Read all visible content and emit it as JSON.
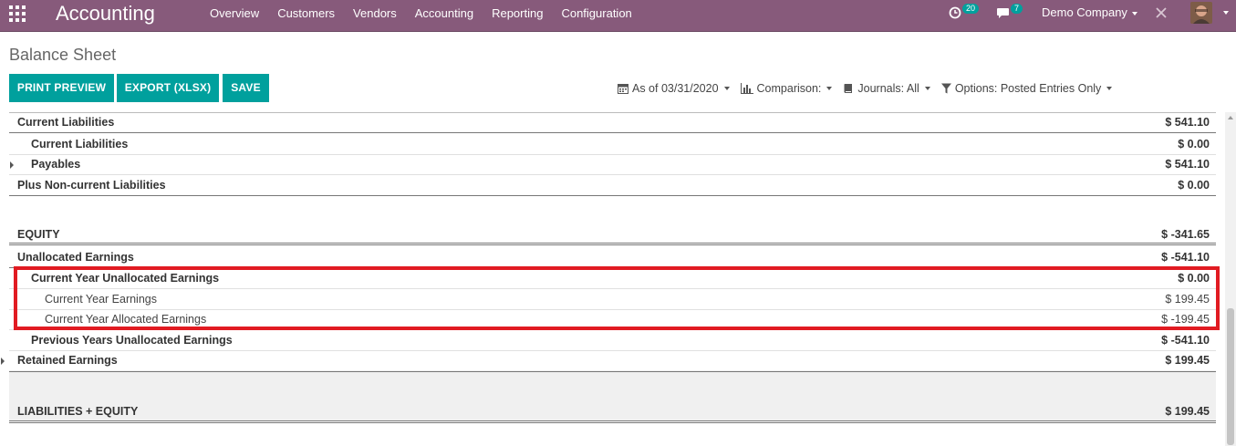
{
  "navbar": {
    "app_title": "Accounting",
    "menu": [
      "Overview",
      "Customers",
      "Vendors",
      "Accounting",
      "Reporting",
      "Configuration"
    ],
    "activity_count": "20",
    "message_count": "7",
    "company": "Demo Company",
    "brand_color": "#875a7b"
  },
  "control_panel": {
    "title": "Balance Sheet",
    "buttons": {
      "print_preview": "PRINT PREVIEW",
      "export_xlsx": "EXPORT (XLSX)",
      "save": "SAVE"
    },
    "button_color": "#00a09d",
    "filters": {
      "date": "As of 03/31/2020",
      "comparison": "Comparison:",
      "journals": "Journals: All",
      "options": "Options: Posted Entries Only"
    }
  },
  "report": {
    "highlight_color": "#e11b22",
    "rows": [
      {
        "label": "Current Liabilities",
        "amount": "$ 541.10"
      },
      {
        "label": "Current Liabilities",
        "amount": "$ 0.00"
      },
      {
        "label": "Payables",
        "amount": "$ 541.10"
      },
      {
        "label": "Plus Non-current Liabilities",
        "amount": "$ 0.00"
      },
      {
        "label": "EQUITY",
        "amount": "$ -341.65"
      },
      {
        "label": "Unallocated Earnings",
        "amount": "$ -541.10"
      },
      {
        "label": "Current Year Unallocated Earnings",
        "amount": "$ 0.00"
      },
      {
        "label": "Current Year Earnings",
        "amount": "$ 199.45"
      },
      {
        "label": "Current Year Allocated Earnings",
        "amount": "$ -199.45"
      },
      {
        "label": "Previous Years Unallocated Earnings",
        "amount": "$ -541.10"
      },
      {
        "label": "Retained Earnings",
        "amount": "$ 199.45"
      },
      {
        "label": "LIABILITIES + EQUITY",
        "amount": "$ 199.45"
      }
    ]
  }
}
